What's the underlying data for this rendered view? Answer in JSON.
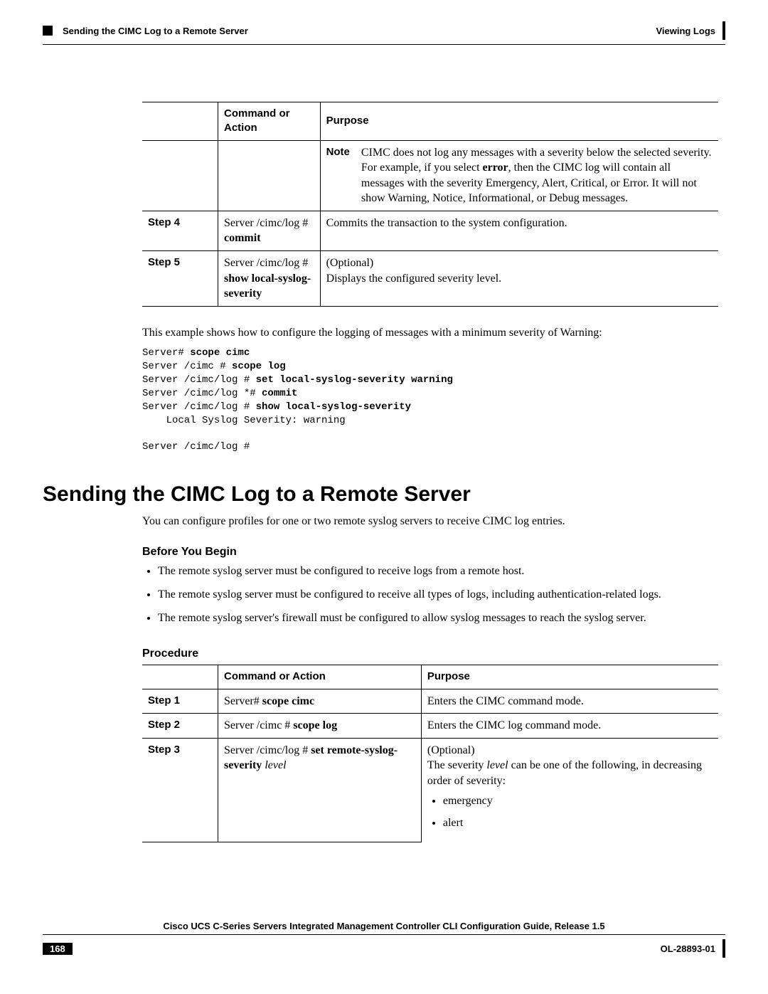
{
  "header": {
    "section_running": "Sending the CIMC Log to a Remote Server",
    "chapter": "Viewing Logs"
  },
  "table1": {
    "headers": {
      "col1": "",
      "col2": "Command or Action",
      "col3": "Purpose"
    },
    "note_label": "Note",
    "note_text_pre": "CIMC does not log any messages with a severity below the selected severity. For example, if you select ",
    "note_bold": "error",
    "note_text_post": ", then the CIMC log will contain all messages with the severity Emergency, Alert, Critical, or Error. It will not show Warning, Notice, Informational, or Debug messages.",
    "rows": [
      {
        "step": "Step 4",
        "cmd_pre": "Server /cimc/log # ",
        "cmd_bold": "commit",
        "purpose": "Commits the transaction to the system configuration."
      },
      {
        "step": "Step 5",
        "cmd_pre": "Server /cimc/log # ",
        "cmd_bold": "show local-syslog-severity",
        "purpose_line1": "(Optional)",
        "purpose_line2": "Displays the configured severity level."
      }
    ]
  },
  "example": {
    "intro": "This example shows how to configure the logging of messages with a minimum severity of Warning:",
    "lines": {
      "l1a": "Server# ",
      "l1b": "scope cimc",
      "l2a": "Server /cimc # ",
      "l2b": "scope log",
      "l3a": "Server /cimc/log # ",
      "l3b": "set local-syslog-severity warning",
      "l4a": "Server /cimc/log *# ",
      "l4b": "commit",
      "l5a": "Server /cimc/log # ",
      "l5b": "show local-syslog-severity",
      "l6": "    Local Syslog Severity: warning",
      "l7": "",
      "l8": "Server /cimc/log #"
    }
  },
  "section": {
    "heading": "Sending the CIMC Log to a Remote Server",
    "intro": "You can configure profiles for one or two remote syslog servers to receive CIMC log entries.",
    "before_heading": "Before You Begin",
    "before_items": [
      "The remote syslog server must be configured to receive logs from a remote host.",
      "The remote syslog server must be configured to receive all types of logs, including authentication-related logs.",
      "The remote syslog server's firewall must be configured to allow syslog messages to reach the syslog server."
    ],
    "procedure_heading": "Procedure"
  },
  "table2": {
    "headers": {
      "col1": "",
      "col2": "Command or Action",
      "col3": "Purpose"
    },
    "rows": [
      {
        "step": "Step 1",
        "cmd_pre": "Server# ",
        "cmd_bold": "scope cimc",
        "purpose": "Enters the CIMC command mode."
      },
      {
        "step": "Step 2",
        "cmd_pre": "Server /cimc # ",
        "cmd_bold": "scope log",
        "purpose": "Enters the CIMC log command mode."
      },
      {
        "step": "Step 3",
        "cmd_pre": "Server /cimc/log # ",
        "cmd_bold": "set remote-syslog-severity",
        "cmd_italic": " level",
        "purpose_line1": "(Optional)",
        "purpose_line2a": "The severity ",
        "purpose_line2_italic": "level",
        "purpose_line2b": " can be one of the following, in decreasing order of severity:",
        "sub_items": [
          "emergency",
          "alert"
        ]
      }
    ]
  },
  "footer": {
    "book_title": "Cisco UCS C-Series Servers Integrated Management Controller CLI Configuration Guide, Release 1.5",
    "page": "168",
    "doc_id": "OL-28893-01"
  }
}
